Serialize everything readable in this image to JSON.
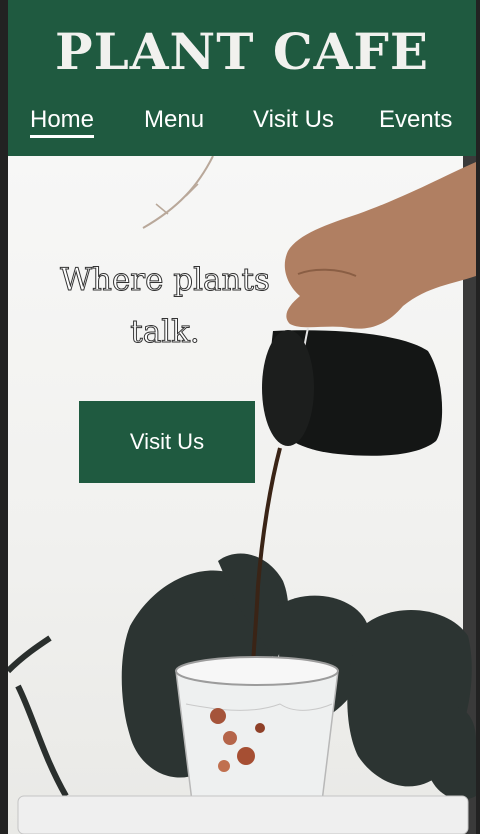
{
  "brand": {
    "name": "PLANT CAFE"
  },
  "nav": {
    "items": [
      {
        "label": "Home"
      },
      {
        "label": "Menu"
      },
      {
        "label": "Visit Us"
      },
      {
        "label": "Events"
      }
    ]
  },
  "hero": {
    "tagline": "Where plants talk.",
    "cta_label": "Visit Us"
  },
  "colors": {
    "brand_green": "#1f5a40",
    "text_light": "#ffffff"
  },
  "icons": {
    "hero_image": "coffee-pour-photo"
  }
}
